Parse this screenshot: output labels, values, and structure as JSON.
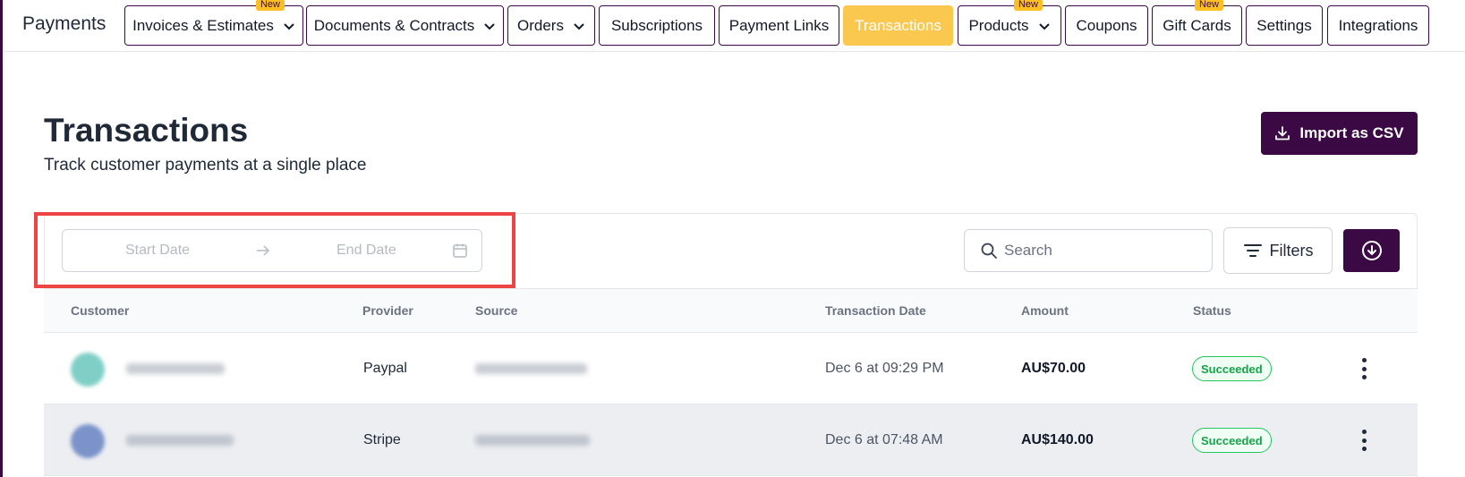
{
  "app": {
    "title": "Payments"
  },
  "nav": {
    "tabs": [
      {
        "label": "Invoices & Estimates",
        "has_dropdown": true,
        "badge": "New"
      },
      {
        "label": "Documents & Contracts",
        "has_dropdown": true
      },
      {
        "label": "Orders",
        "has_dropdown": true
      },
      {
        "label": "Subscriptions"
      },
      {
        "label": "Payment Links"
      },
      {
        "label": "Transactions",
        "active": true
      },
      {
        "label": "Products",
        "has_dropdown": true,
        "badge": "New"
      },
      {
        "label": "Coupons"
      },
      {
        "label": "Gift Cards",
        "badge": "New"
      },
      {
        "label": "Settings"
      },
      {
        "label": "Integrations"
      }
    ]
  },
  "header": {
    "title": "Transactions",
    "subtitle": "Track customer payments at a single place",
    "import_label": "Import as CSV"
  },
  "toolbar": {
    "start_date_placeholder": "Start Date",
    "end_date_placeholder": "End Date",
    "search_placeholder": "Search",
    "filters_label": "Filters"
  },
  "table": {
    "columns": [
      "Customer",
      "Provider",
      "Source",
      "Transaction Date",
      "Amount",
      "Status"
    ],
    "rows": [
      {
        "provider": "Paypal",
        "date": "Dec 6 at 09:29 PM",
        "amount": "AU$70.00",
        "status": "Succeeded",
        "avatar_color": "#7fcfc7"
      },
      {
        "provider": "Stripe",
        "date": "Dec 6 at 07:48 AM",
        "amount": "AU$140.00",
        "status": "Succeeded",
        "avatar_color": "#7b93c9"
      }
    ]
  },
  "colors": {
    "brand": "#3b0a45",
    "active_tab": "#fbc84f",
    "badge": "#fbbf24",
    "success": "#16a34a",
    "highlight": "#ef4444"
  }
}
